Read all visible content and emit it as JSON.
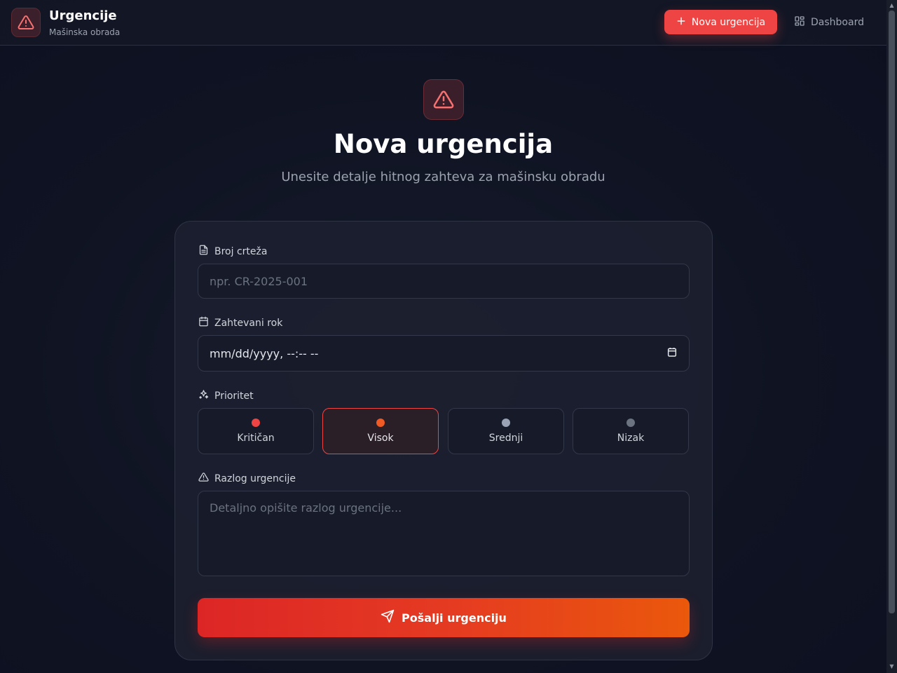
{
  "header": {
    "title": "Urgencije",
    "subtitle": "Mašinska obrada",
    "new_button_label": "Nova urgencija",
    "dashboard_label": "Dashboard"
  },
  "hero": {
    "title": "Nova urgencija",
    "subtitle": "Unesite detalje hitnog zahteva za mašinsku obradu"
  },
  "form": {
    "drawing_number": {
      "label": "Broj crteža",
      "placeholder": "npr. CR-2025-001",
      "value": ""
    },
    "deadline": {
      "label": "Zahtevani rok",
      "value": "mm/dd/yyyy, --:-- --"
    },
    "priority": {
      "label": "Prioritet",
      "selected": "Visok",
      "options": [
        {
          "label": "Kritičan",
          "color": "#ef4444"
        },
        {
          "label": "Visok",
          "color": "#f05a24"
        },
        {
          "label": "Srednji",
          "color": "#9aa3b5"
        },
        {
          "label": "Nizak",
          "color": "#6b7280"
        }
      ]
    },
    "reason": {
      "label": "Razlog urgencije",
      "placeholder": "Detaljno opišite razlog urgencije...",
      "value": ""
    },
    "submit_label": "Pošalji urgenciju"
  },
  "colors": {
    "accent": "#ef4444",
    "accent_orange": "#ea580c",
    "background": "#0f1322"
  }
}
